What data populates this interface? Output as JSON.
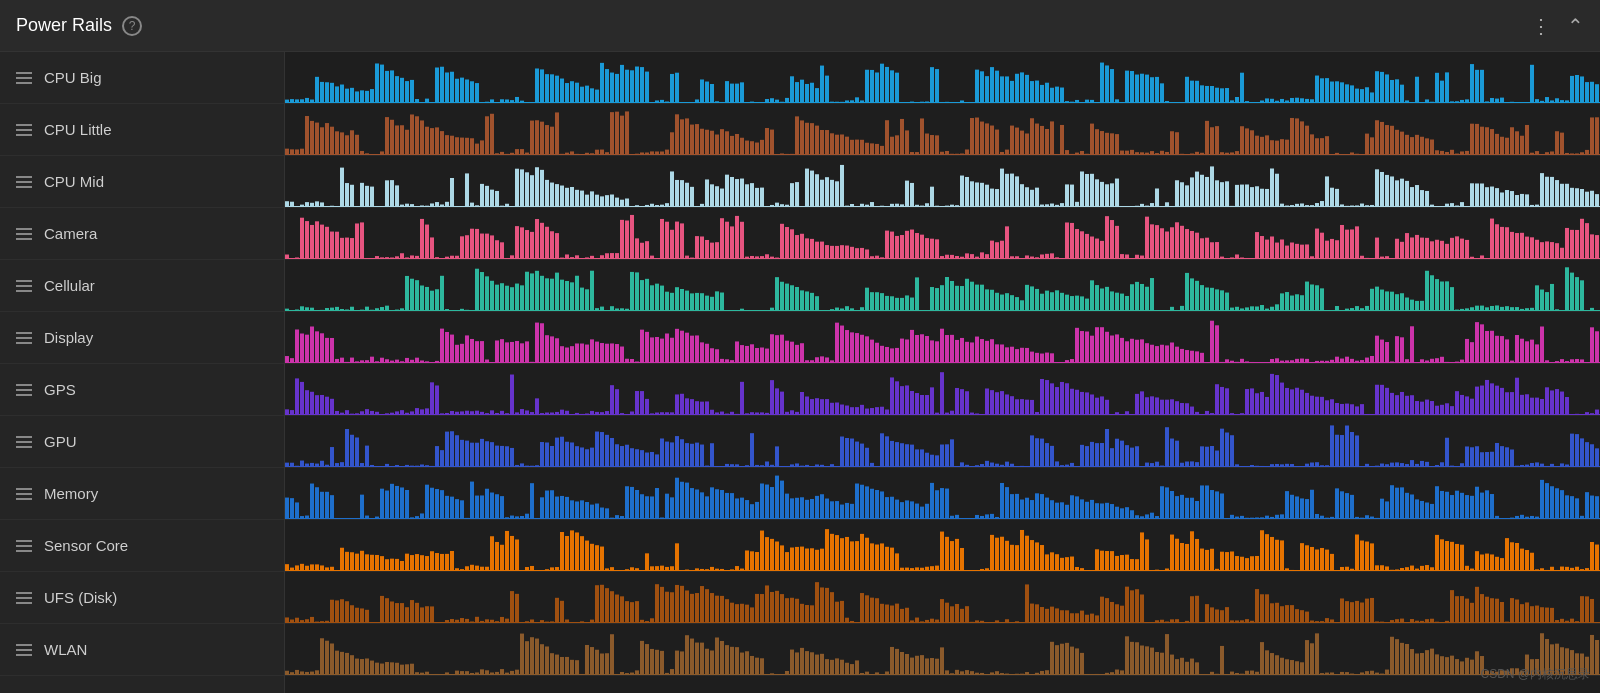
{
  "header": {
    "title": "Power Rails",
    "help_label": "?",
    "more_icon": "⋮",
    "collapse_icon": "⌃"
  },
  "sidebar": {
    "items": [
      {
        "label": "CPU Big",
        "color": "#1a9ad7"
      },
      {
        "label": "CPU Little",
        "color": "#a0522d"
      },
      {
        "label": "CPU Mid",
        "color": "#add8e6"
      },
      {
        "label": "Camera",
        "color": "#e75480"
      },
      {
        "label": "Cellular",
        "color": "#2db89e"
      },
      {
        "label": "Display",
        "color": "#cc33aa"
      },
      {
        "label": "GPS",
        "color": "#6633cc"
      },
      {
        "label": "GPU",
        "color": "#3355cc"
      },
      {
        "label": "Memory",
        "color": "#1e6fcc"
      },
      {
        "label": "Sensor Core",
        "color": "#e67300"
      },
      {
        "label": "UFS (Disk)",
        "color": "#a05010"
      },
      {
        "label": "WLAN",
        "color": "#8b5a2b"
      }
    ]
  },
  "watermark": "CSDN @内核沉思录"
}
